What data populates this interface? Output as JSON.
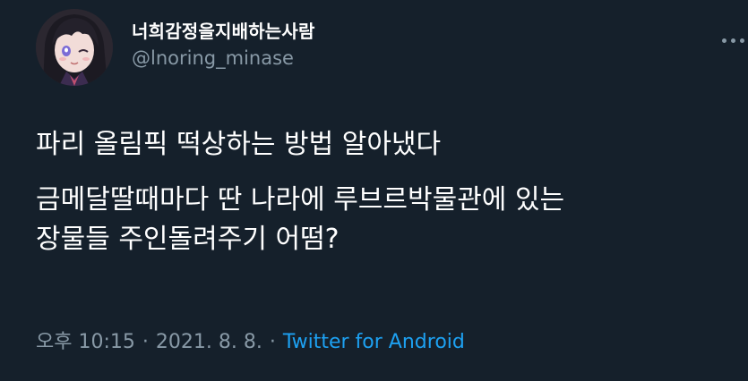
{
  "user": {
    "display_name": "너희감정을지배하는사람",
    "handle": "@lnoring_minase"
  },
  "tweet": {
    "paragraphs": [
      "파리 올림픽 떡상하는 방법 알아냈다",
      "금메달딸때마다 딴 나라에 루브르박물관에 있는\n장물들 주인돌려주기 어떰?"
    ]
  },
  "meta": {
    "time": "오후 10:15",
    "separator": "·",
    "date": "2021. 8. 8.",
    "source": "Twitter for Android"
  },
  "icons": {
    "more": "more-horizontal-icon"
  },
  "colors": {
    "background": "#15202b",
    "text_primary": "#ffffff",
    "text_secondary": "#8899a6",
    "link": "#1da1f2"
  }
}
